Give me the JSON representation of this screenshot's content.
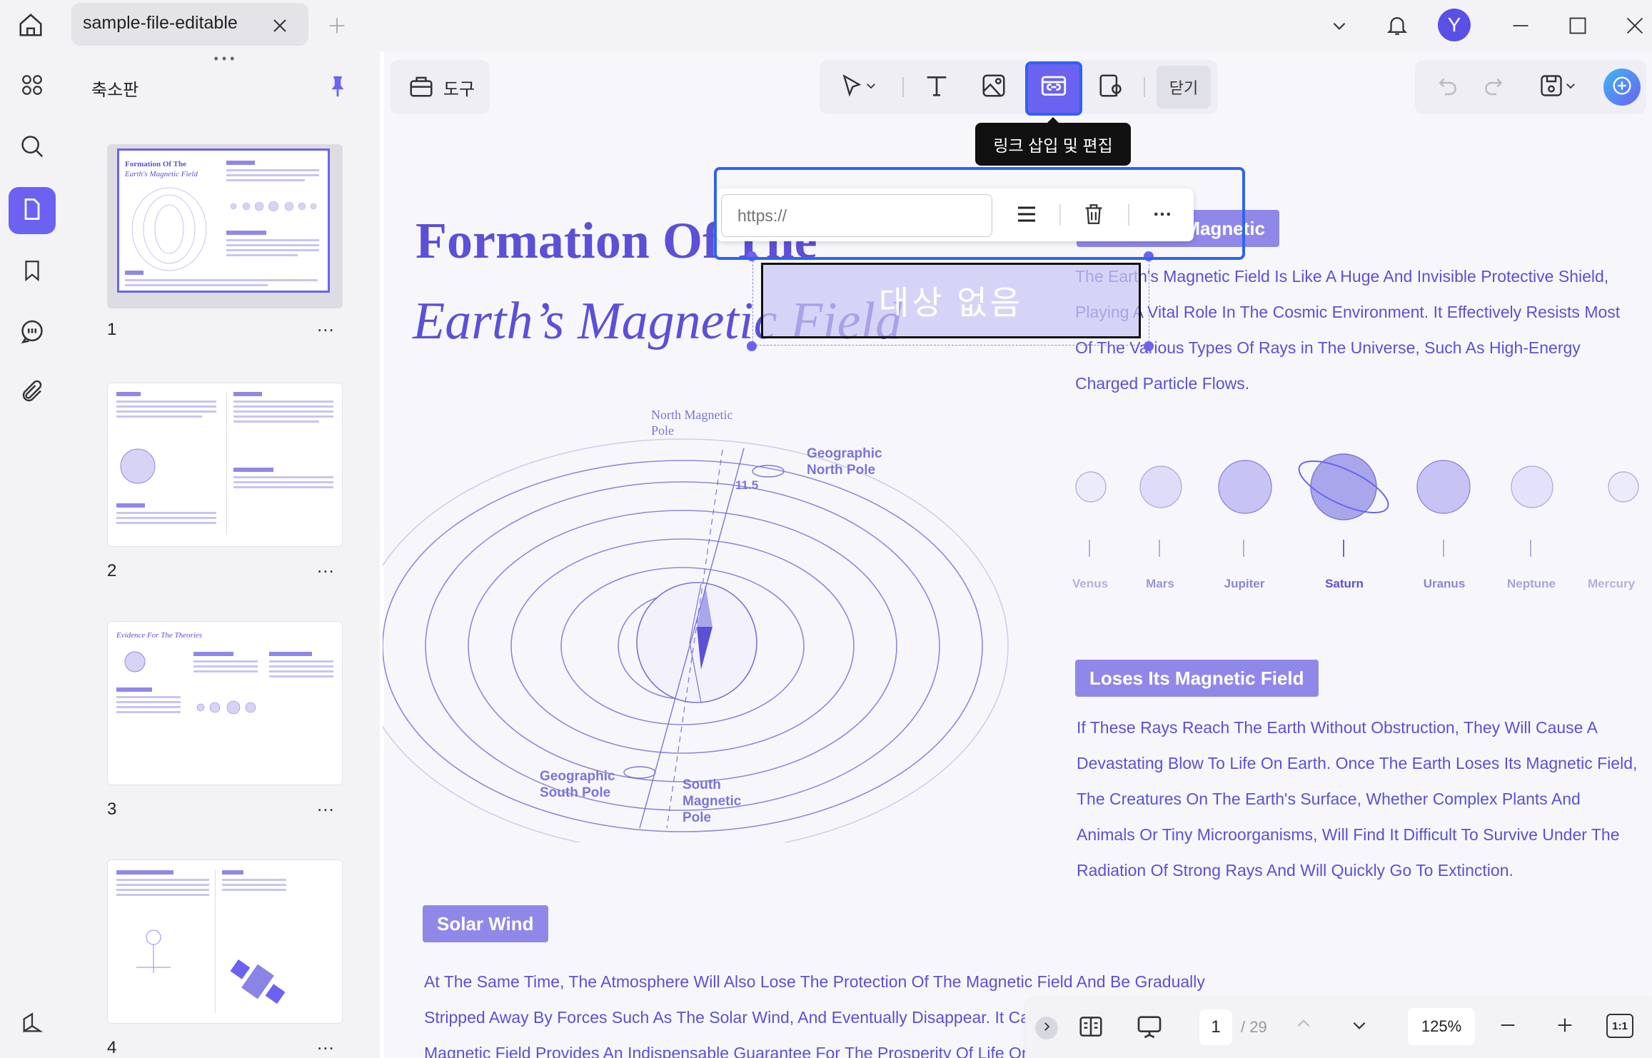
{
  "window": {
    "tab_title": "sample-file-editable",
    "avatar_letter": "Y"
  },
  "sidebar": {
    "panel_title": "축소판",
    "thumbnails": [
      {
        "page": "1",
        "more": "..."
      },
      {
        "page": "2",
        "more": "..."
      },
      {
        "page": "3",
        "more": "..."
      },
      {
        "page": "4",
        "more": "..."
      }
    ]
  },
  "toolbar": {
    "tools_label": "도구",
    "close_label": "닫기",
    "tooltip": "링크 삽입 및 편집"
  },
  "link_popup": {
    "url_placeholder": "https://",
    "target_text": "대상 없음"
  },
  "document": {
    "title_line1": "Formation Of The",
    "title_line2": "Earth’s Magnetic Field",
    "badge_magnetic": "Magnetic",
    "para_magnetic": "The Earth's Magnetic Field Is Like A Huge And Invisible Protective Shield, Playing A Vital Role In The Cosmic Environment. It Effectively Resists Most Of The Various Types Of Rays in The Universe, Such As High-Energy Charged Particle Flows.",
    "diagram_labels": {
      "north_magnetic": "North Magnetic Pole",
      "geo_north": "Geographic North Pole",
      "angle": "11.5",
      "geo_south": "Geographic South Pole",
      "south_magnetic": "South Magnetic Pole"
    },
    "planets": [
      "Venus",
      "Mars",
      "Jupiter",
      "Saturn",
      "Uranus",
      "Neptune",
      "Mercury"
    ],
    "badge_loses": "Loses Its Magnetic Field",
    "para_loses": "If These Rays Reach The Earth Without Obstruction, They Will Cause A Devastating Blow To Life On Earth. Once The Earth Loses Its Magnetic Field, The Creatures On The Earth's Surface, Whether Complex Plants And Animals Or Tiny Microorganisms, Will Find It Difficult To Survive Under The Radiation Of Strong Rays And Will Quickly Go To Extinction.",
    "badge_solar": "Solar Wind",
    "para_solar": "At The Same Time, The Atmosphere Will Also Lose The Protection Of The Magnetic Field And Be Gradually Stripped Away By Forces Such As The Solar Wind, And Eventually Disappear. It Can Be Said That The Earth's Magnetic Field Provides An Indispensable Guarantee For The Prosperity Of Life On Earth."
  },
  "bottom_bar": {
    "current_page": "1",
    "total_pages": "/ 29",
    "zoom": "125%",
    "fit_label": "1:1"
  },
  "colors": {
    "accent": "#6b62f2",
    "doc_text": "#5b50d6",
    "highlight_border": "#2f63f1"
  }
}
